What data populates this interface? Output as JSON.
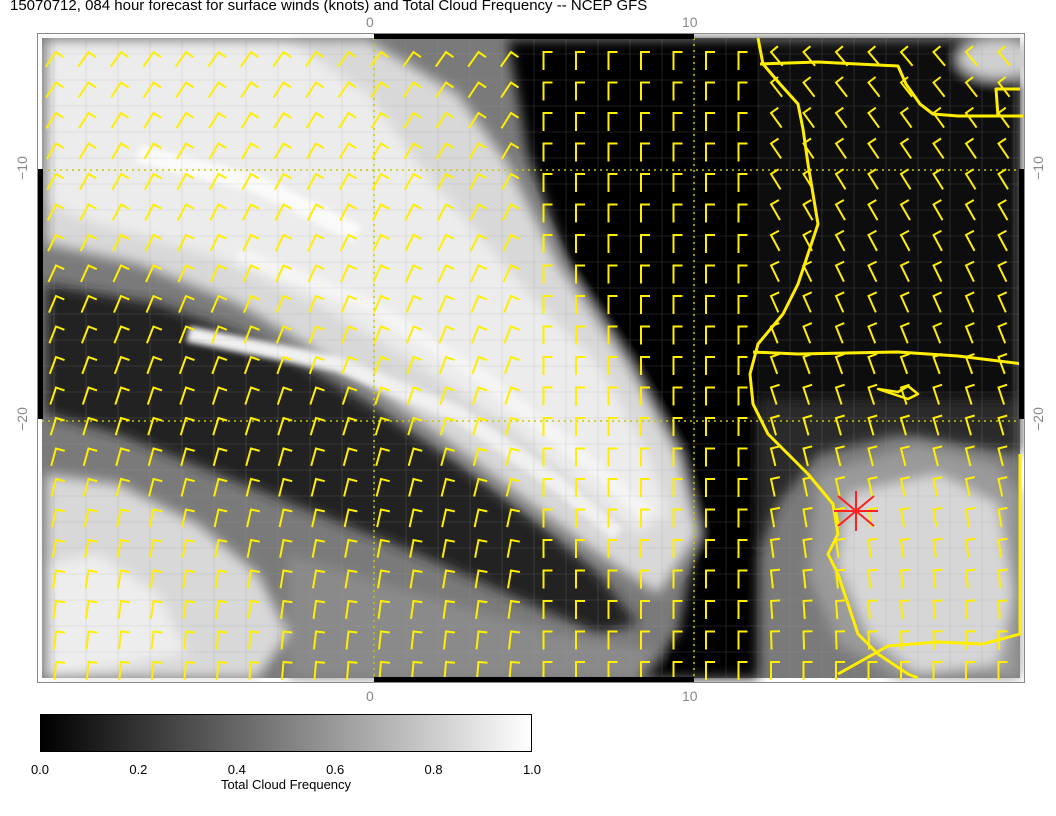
{
  "title": "15070712, 084 hour forecast for surface winds (knots) and Total Cloud Frequency -- NCEP GFS",
  "map": {
    "x_ticks": [
      "0",
      "10"
    ],
    "y_ticks": [
      "−10",
      "−20"
    ],
    "colors": {
      "coast": "#ffee00",
      "barbs": "#ffee00",
      "marker": "#ff2020",
      "grid": "#c8c800"
    },
    "marker_icon": "asterisk-marker"
  },
  "colorbar": {
    "ticks": [
      "0.0",
      "0.2",
      "0.4",
      "0.6",
      "0.8",
      "1.0"
    ],
    "label": "Total Cloud Frequency",
    "range": [
      0.0,
      1.0
    ]
  }
}
